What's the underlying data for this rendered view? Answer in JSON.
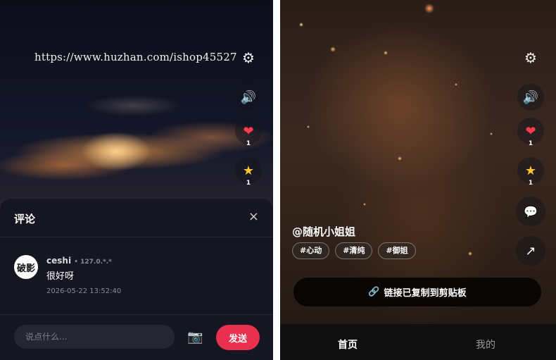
{
  "left": {
    "watermark_url": "https://www.huzhan.com/ishop45527",
    "icons": [
      "gear-icon",
      "speaker-icon",
      "heart-icon",
      "star-icon"
    ],
    "like_count": "1",
    "favorite_count": "1",
    "comments": {
      "title": "评论",
      "close_label": "×",
      "items": [
        {
          "avatar_text": "破影",
          "user": "ceshi",
          "ip": "• 127.0.*.*",
          "text": "很好呀",
          "time": "2026-05-22 13:52:40"
        }
      ],
      "input_placeholder": "说点什么...",
      "camera_icon": "📷",
      "send_label": "发送"
    }
  },
  "right": {
    "like_count": "1",
    "favorite_count": "1",
    "username": "@随机小姐姐",
    "tags": [
      "#心动",
      "#清纯",
      "#御姐"
    ],
    "toast": "链接已复制到剪贴板",
    "tabs": {
      "home": "首页",
      "mine": "我的"
    }
  },
  "colors": {
    "accent": "#e8304f",
    "sheet": "#161622"
  }
}
